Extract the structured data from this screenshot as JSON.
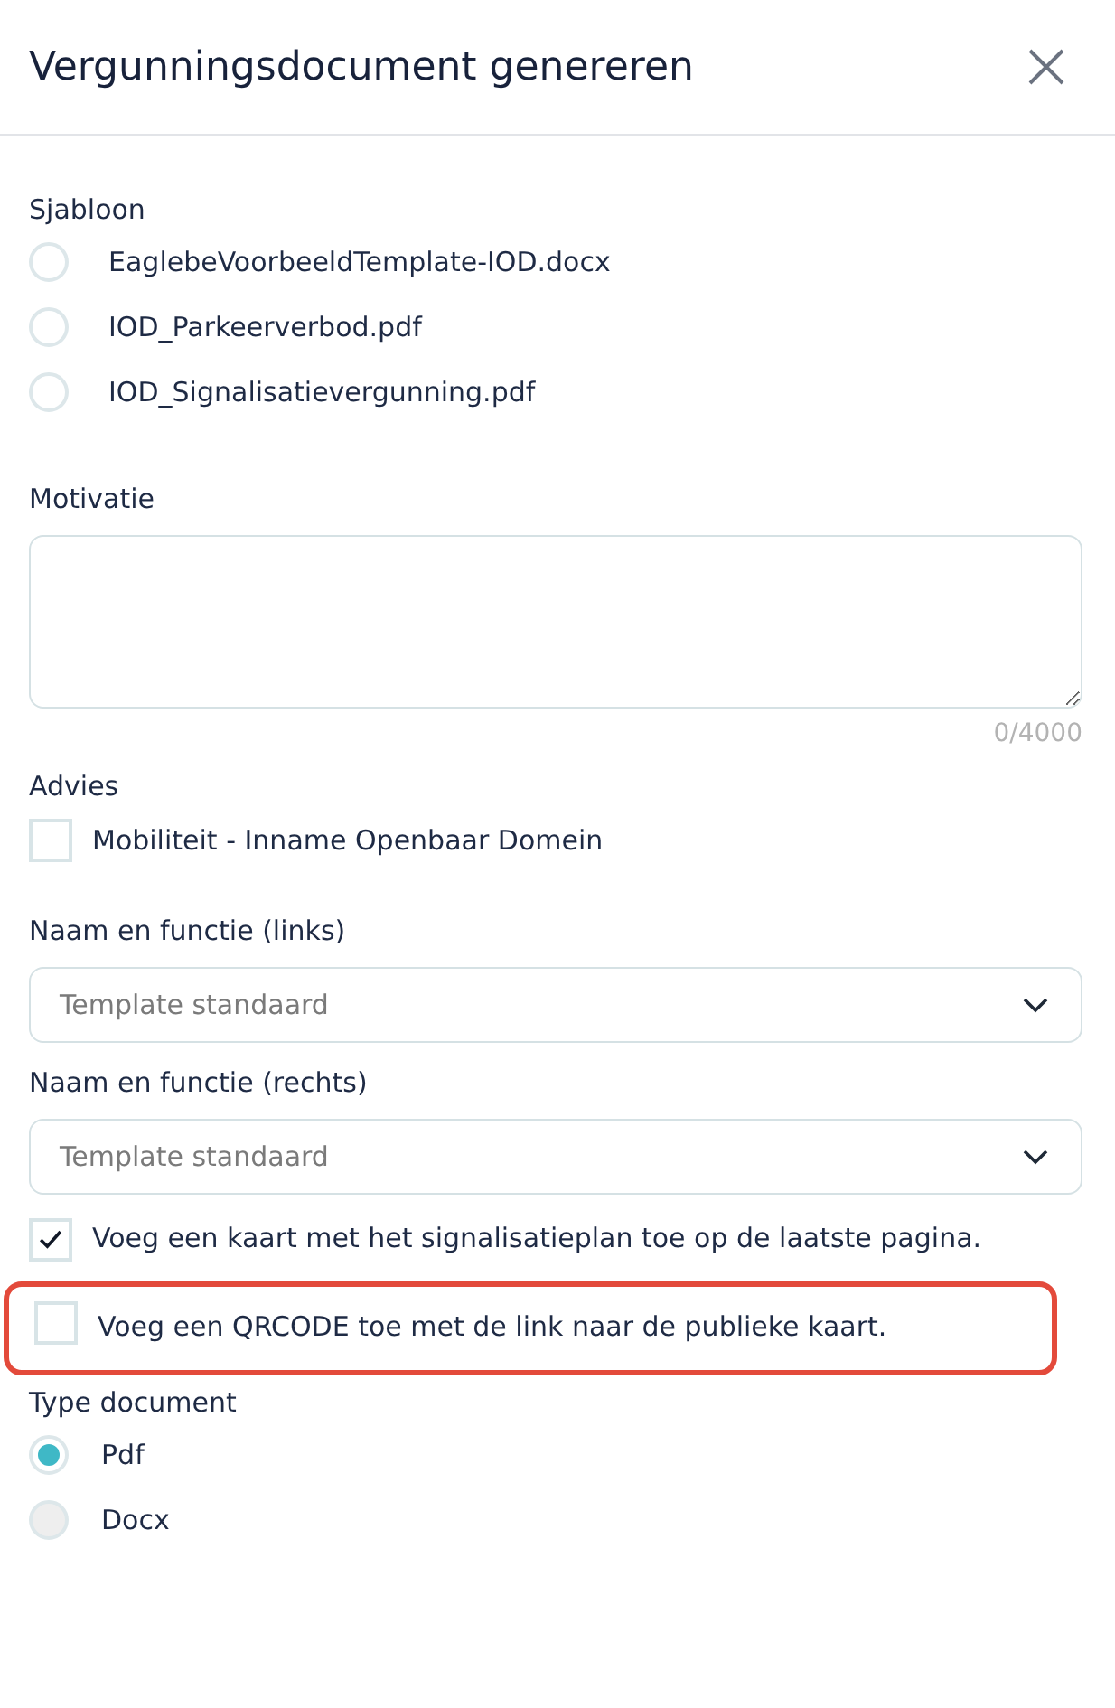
{
  "header": {
    "title": "Vergunningsdocument genereren"
  },
  "template": {
    "label": "Sjabloon",
    "options": [
      {
        "label": "EaglebeVoorbeeldTemplate-IOD.docx",
        "selected": false
      },
      {
        "label": "IOD_Parkeerverbod.pdf",
        "selected": false
      },
      {
        "label": "IOD_Signalisatievergunning.pdf",
        "selected": false
      }
    ]
  },
  "motivation": {
    "label": "Motivatie",
    "counter": "0/4000"
  },
  "advice": {
    "label": "Advies",
    "options": [
      {
        "label": "Mobiliteit - Inname Openbaar Domein",
        "checked": false
      }
    ]
  },
  "selects": [
    {
      "label": "Naam en functie (links)",
      "placeholder": "Template standaard"
    },
    {
      "label": "Naam en functie (rechts)",
      "placeholder": "Template standaard"
    }
  ],
  "options": [
    {
      "label": "Voeg een kaart met het signalisatieplan toe op de laatste pagina.",
      "checked": true,
      "highlighted": false
    },
    {
      "label": "Voeg een QRCODE toe met de link naar de publieke kaart.",
      "checked": false,
      "highlighted": true
    }
  ],
  "document_type": {
    "label": "Type document",
    "options": [
      {
        "label": "Pdf",
        "selected": true,
        "disabled": false
      },
      {
        "label": "Docx",
        "selected": false,
        "disabled": true
      }
    ]
  }
}
